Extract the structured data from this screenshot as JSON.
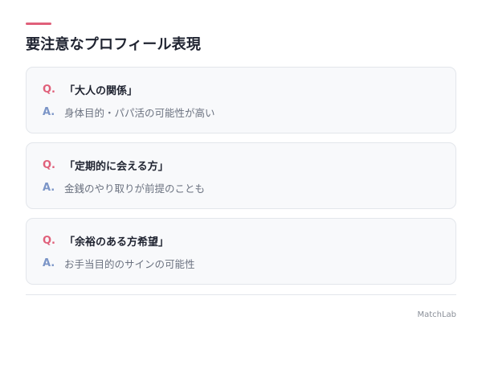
{
  "colors": {
    "accent": "#e0607a",
    "question_mark": "#e0607a",
    "answer_mark": "#7b95c7"
  },
  "header": {
    "title": "要注意なプロフィール表現"
  },
  "qa_items": [
    {
      "q_mark": "Q.",
      "question": "「大人の関係」",
      "a_mark": "A.",
      "answer": "身体目的・パパ活の可能性が高い"
    },
    {
      "q_mark": "Q.",
      "question": "「定期的に会える方」",
      "a_mark": "A.",
      "answer": "金銭のやり取りが前提のことも"
    },
    {
      "q_mark": "Q.",
      "question": "「余裕のある方希望」",
      "a_mark": "A.",
      "answer": "お手当目的のサインの可能性"
    }
  ],
  "footer": {
    "brand": "MatchLab"
  }
}
